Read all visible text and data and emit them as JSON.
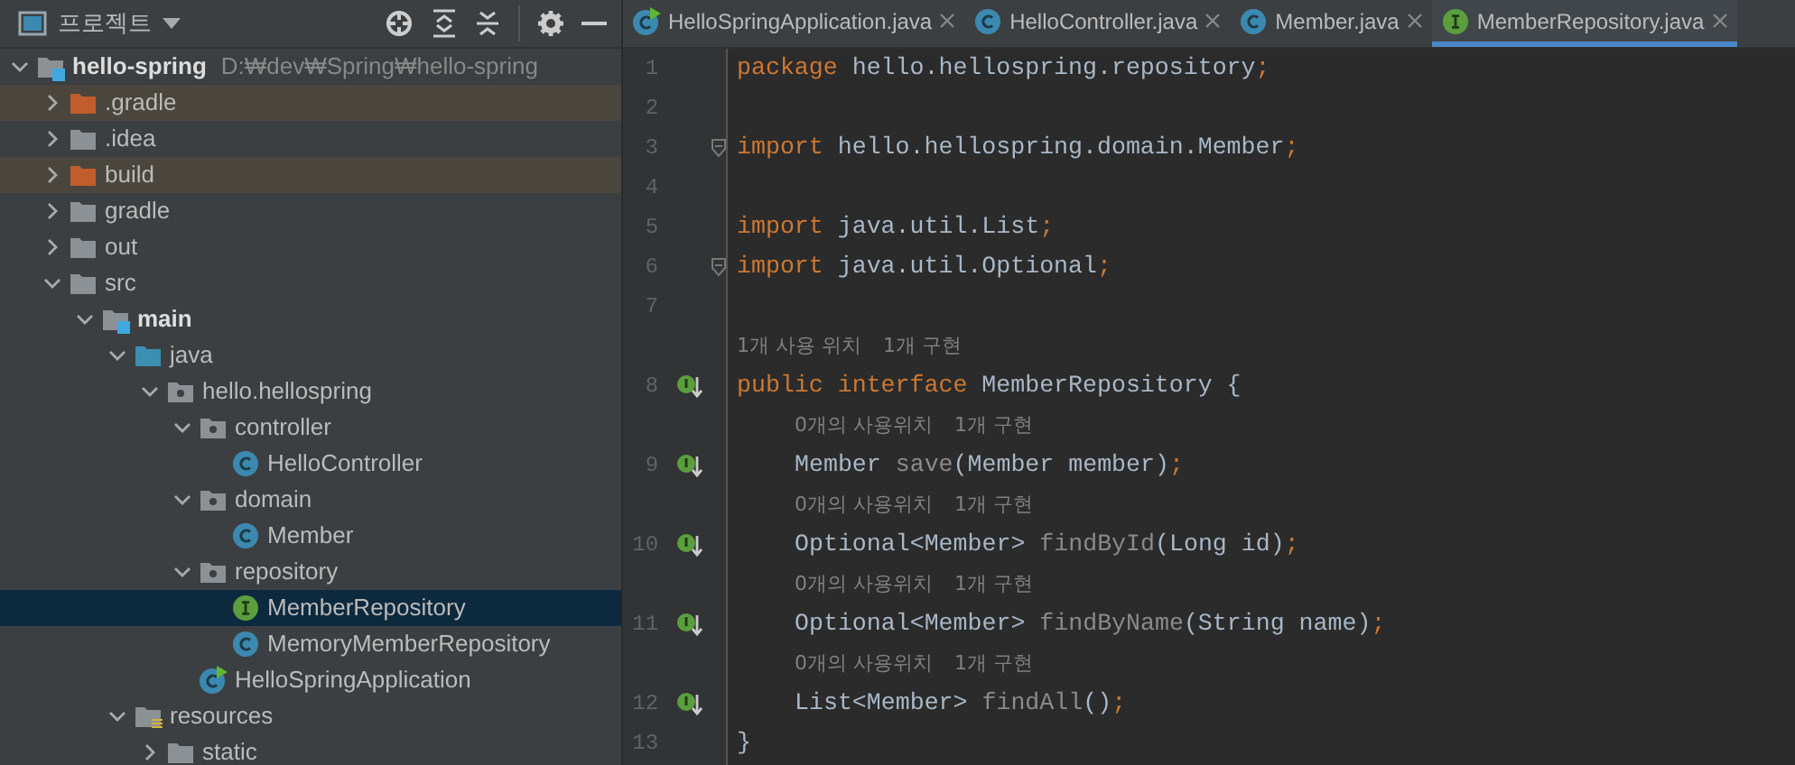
{
  "project_panel": {
    "title": "프로젝트",
    "tree": [
      {
        "name": "hello-spring",
        "kind": "module",
        "path": "D:₩dev₩Spring₩hello-spring",
        "expanded": true,
        "selected": false,
        "children": [
          {
            "name": ".gradle",
            "kind": "excluded-folder",
            "expanded": false,
            "selected": false
          },
          {
            "name": ".idea",
            "kind": "folder",
            "expanded": false,
            "selected": false
          },
          {
            "name": "build",
            "kind": "excluded-folder",
            "expanded": false,
            "selected": false
          },
          {
            "name": "gradle",
            "kind": "folder",
            "expanded": false,
            "selected": false
          },
          {
            "name": "out",
            "kind": "folder",
            "expanded": false,
            "selected": false
          },
          {
            "name": "src",
            "kind": "folder",
            "expanded": true,
            "selected": false,
            "children": [
              {
                "name": "main",
                "kind": "module",
                "expanded": true,
                "selected": false,
                "children": [
                  {
                    "name": "java",
                    "kind": "source-root",
                    "expanded": true,
                    "selected": false,
                    "children": [
                      {
                        "name": "hello.hellospring",
                        "kind": "package",
                        "expanded": true,
                        "selected": false,
                        "children": [
                          {
                            "name": "controller",
                            "kind": "package",
                            "expanded": true,
                            "selected": false,
                            "children": [
                              {
                                "name": "HelloController",
                                "kind": "class",
                                "selected": false
                              }
                            ]
                          },
                          {
                            "name": "domain",
                            "kind": "package",
                            "expanded": true,
                            "selected": false,
                            "children": [
                              {
                                "name": "Member",
                                "kind": "class",
                                "selected": false
                              }
                            ]
                          },
                          {
                            "name": "repository",
                            "kind": "package",
                            "expanded": true,
                            "selected": false,
                            "children": [
                              {
                                "name": "MemberRepository",
                                "kind": "interface",
                                "selected": true
                              },
                              {
                                "name": "MemoryMemberRepository",
                                "kind": "class",
                                "selected": false
                              }
                            ]
                          },
                          {
                            "name": "HelloSpringApplication",
                            "kind": "spring-app",
                            "selected": false
                          }
                        ]
                      }
                    ]
                  },
                  {
                    "name": "resources",
                    "kind": "resources-folder",
                    "expanded": true,
                    "selected": false,
                    "children": [
                      {
                        "name": "static",
                        "kind": "folder",
                        "expanded": false,
                        "selected": false
                      }
                    ]
                  }
                ]
              }
            ]
          }
        ]
      }
    ]
  },
  "editor": {
    "tabs": [
      {
        "label": "HelloSpringApplication.java",
        "kind": "spring-app",
        "selected": false
      },
      {
        "label": "HelloController.java",
        "kind": "class",
        "selected": false
      },
      {
        "label": "Member.java",
        "kind": "class",
        "selected": false
      },
      {
        "label": "MemberRepository.java",
        "kind": "interface",
        "selected": true
      }
    ],
    "lines": [
      {
        "kind": "code",
        "number": "1",
        "fold_marker": false,
        "implemented": false,
        "tokens": [
          {
            "kind": "keyword",
            "text": "package "
          },
          {
            "kind": "plain",
            "text": "hello.hellospring.repository"
          },
          {
            "kind": "keyword",
            "text": ";"
          }
        ]
      },
      {
        "kind": "code",
        "number": "2",
        "fold_marker": false,
        "implemented": false
      },
      {
        "kind": "code",
        "number": "3",
        "fold_marker": true,
        "implemented": false,
        "tokens": [
          {
            "kind": "keyword",
            "text": "import "
          },
          {
            "kind": "plain",
            "text": "hello.hellospring.domain.Member"
          },
          {
            "kind": "keyword",
            "text": ";"
          }
        ]
      },
      {
        "kind": "code",
        "number": "4",
        "fold_marker": false,
        "implemented": false
      },
      {
        "kind": "code",
        "number": "5",
        "fold_marker": false,
        "implemented": false,
        "tokens": [
          {
            "kind": "keyword",
            "text": "import "
          },
          {
            "kind": "plain",
            "text": "java.util.List"
          },
          {
            "kind": "keyword",
            "text": ";"
          }
        ]
      },
      {
        "kind": "code",
        "number": "6",
        "fold_marker": true,
        "implemented": false,
        "tokens": [
          {
            "kind": "keyword",
            "text": "import "
          },
          {
            "kind": "plain",
            "text": "java.util.Optional"
          },
          {
            "kind": "keyword",
            "text": ";"
          }
        ]
      },
      {
        "kind": "code",
        "number": "7",
        "fold_marker": false,
        "implemented": false
      },
      {
        "kind": "hint",
        "parts": [
          "1개 사용 위치",
          "1개 구현"
        ]
      },
      {
        "kind": "code",
        "number": "8",
        "fold_marker": false,
        "implemented": true,
        "tokens": [
          {
            "kind": "keyword",
            "text": "public interface "
          },
          {
            "kind": "plain",
            "text": "MemberRepository {"
          }
        ],
        "children": [
          {
            "kind": "hint",
            "parts": [
              "0개의 사용위치",
              "1개 구현"
            ]
          },
          {
            "kind": "code",
            "number": "9",
            "fold_marker": false,
            "implemented": true,
            "tokens": [
              {
                "kind": "plain",
                "text": "Member "
              },
              {
                "kind": "unused",
                "text": "save"
              },
              {
                "kind": "plain",
                "text": "(Member member)"
              },
              {
                "kind": "keyword",
                "text": ";"
              }
            ]
          },
          {
            "kind": "hint",
            "parts": [
              "0개의 사용위치",
              "1개 구현"
            ]
          },
          {
            "kind": "code",
            "number": "10",
            "fold_marker": false,
            "implemented": true,
            "tokens": [
              {
                "kind": "plain",
                "text": "Optional<Member> "
              },
              {
                "kind": "unused",
                "text": "findById"
              },
              {
                "kind": "plain",
                "text": "(Long id)"
              },
              {
                "kind": "keyword",
                "text": ";"
              }
            ]
          },
          {
            "kind": "hint",
            "parts": [
              "0개의 사용위치",
              "1개 구현"
            ]
          },
          {
            "kind": "code",
            "number": "11",
            "fold_marker": false,
            "implemented": true,
            "tokens": [
              {
                "kind": "plain",
                "text": "Optional<Member> "
              },
              {
                "kind": "unused",
                "text": "findByName"
              },
              {
                "kind": "plain",
                "text": "(String name)"
              },
              {
                "kind": "keyword",
                "text": ";"
              }
            ]
          },
          {
            "kind": "hint",
            "parts": [
              "0개의 사용위치",
              "1개 구현"
            ]
          },
          {
            "kind": "code",
            "number": "12",
            "fold_marker": false,
            "implemented": true,
            "tokens": [
              {
                "kind": "plain",
                "text": "List<Member> "
              },
              {
                "kind": "unused",
                "text": "findAll"
              },
              {
                "kind": "plain",
                "text": "()"
              },
              {
                "kind": "keyword",
                "text": ";"
              }
            ]
          }
        ]
      },
      {
        "kind": "code",
        "number": "13",
        "fold_marker": false,
        "implemented": false,
        "tokens": [
          {
            "kind": "plain",
            "text": "}"
          }
        ]
      }
    ]
  }
}
